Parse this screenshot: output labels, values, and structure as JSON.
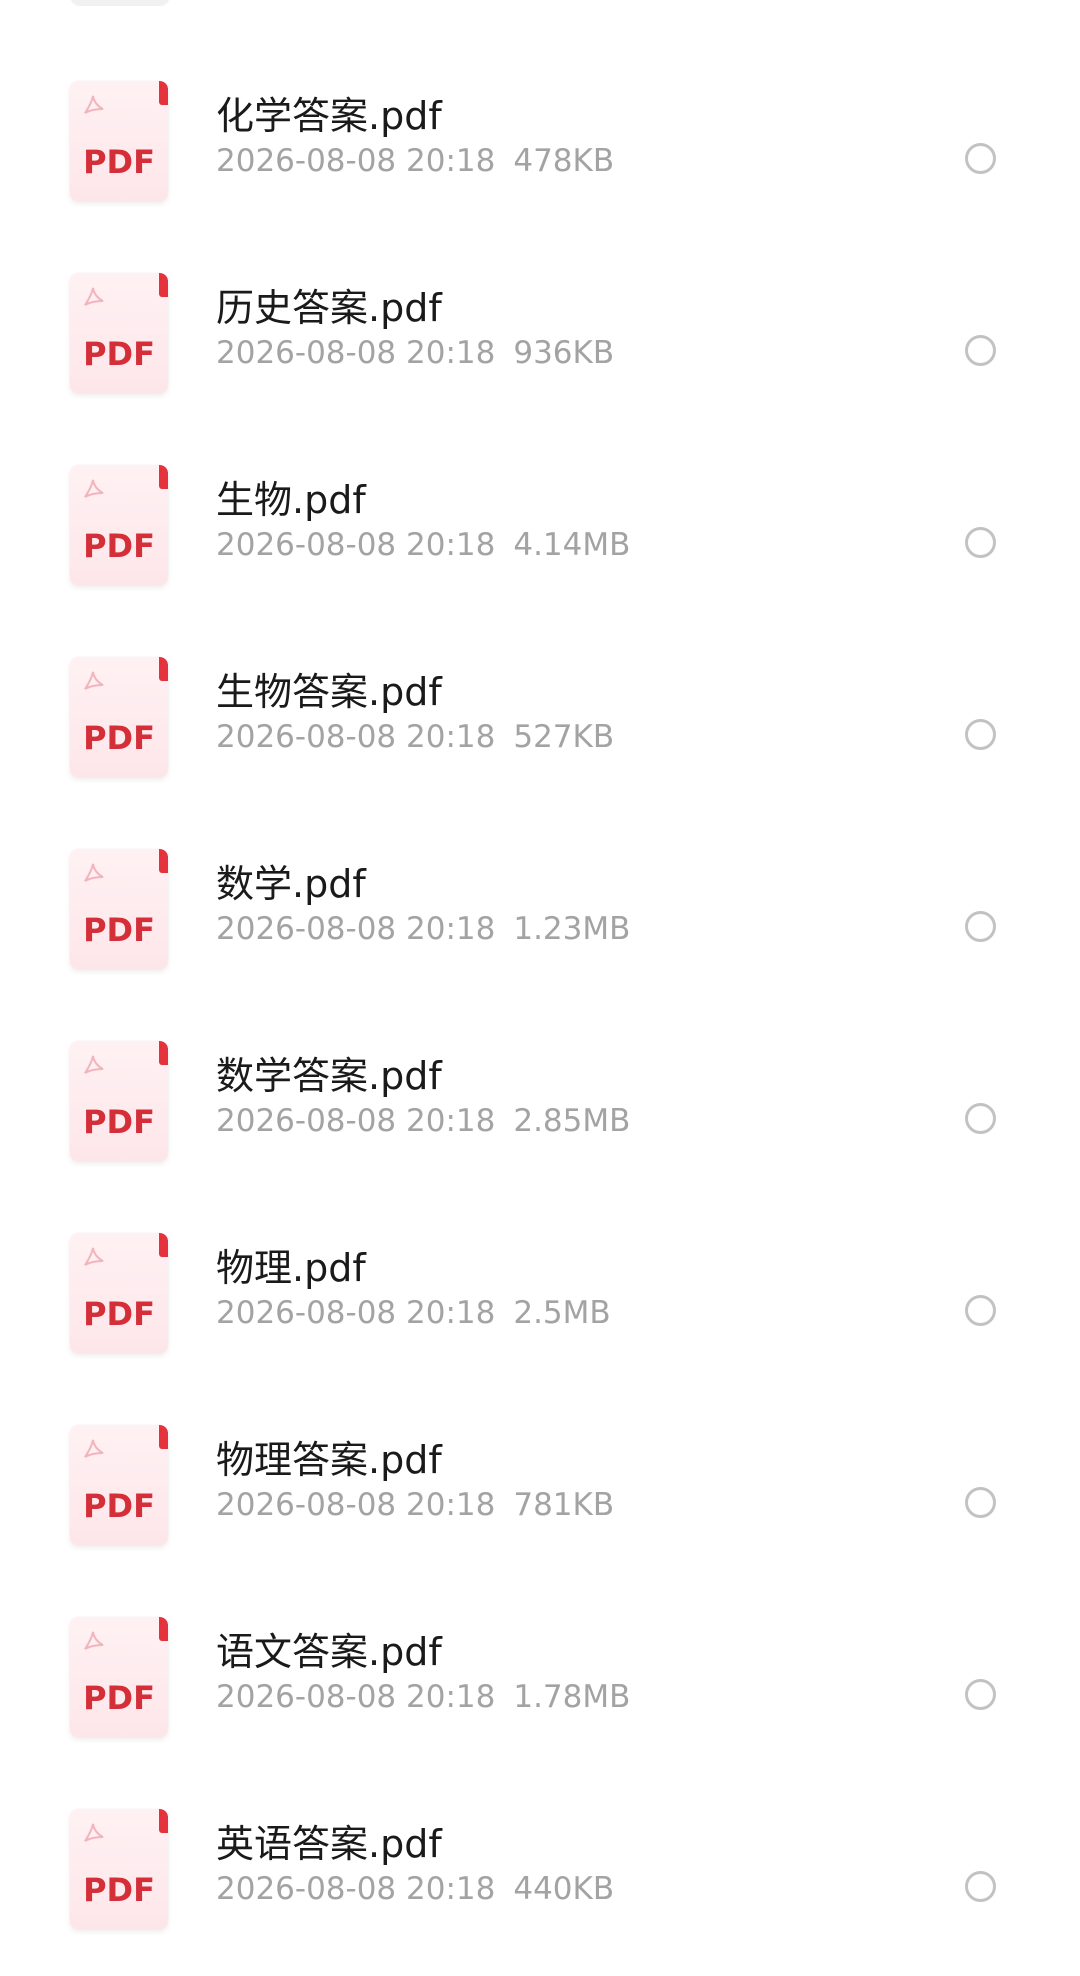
{
  "files": [
    {
      "name": "化学答案.pdf",
      "date": "2026-08-08 20:18",
      "size": "478KB",
      "icon_label": "PDF"
    },
    {
      "name": "历史答案.pdf",
      "date": "2026-08-08 20:18",
      "size": "936KB",
      "icon_label": "PDF"
    },
    {
      "name": "生物.pdf",
      "date": "2026-08-08 20:18",
      "size": "4.14MB",
      "icon_label": "PDF"
    },
    {
      "name": "生物答案.pdf",
      "date": "2026-08-08 20:18",
      "size": "527KB",
      "icon_label": "PDF"
    },
    {
      "name": "数学.pdf",
      "date": "2026-08-08 20:18",
      "size": "1.23MB",
      "icon_label": "PDF"
    },
    {
      "name": "数学答案.pdf",
      "date": "2026-08-08 20:18",
      "size": "2.85MB",
      "icon_label": "PDF"
    },
    {
      "name": "物理.pdf",
      "date": "2026-08-08 20:18",
      "size": "2.5MB",
      "icon_label": "PDF"
    },
    {
      "name": "物理答案.pdf",
      "date": "2026-08-08 20:18",
      "size": "781KB",
      "icon_label": "PDF"
    },
    {
      "name": "语文答案.pdf",
      "date": "2026-08-08 20:18",
      "size": "1.78MB",
      "icon_label": "PDF"
    },
    {
      "name": "英语答案.pdf",
      "date": "2026-08-08 20:18",
      "size": "440KB",
      "icon_label": "PDF"
    }
  ],
  "icon": "pdf-file-icon",
  "colors": {
    "pdf_red": "#d42f39",
    "icon_bg": "#fde6ea",
    "meta_gray": "#a3a3a3",
    "radio_gray": "#c2c2c2"
  }
}
